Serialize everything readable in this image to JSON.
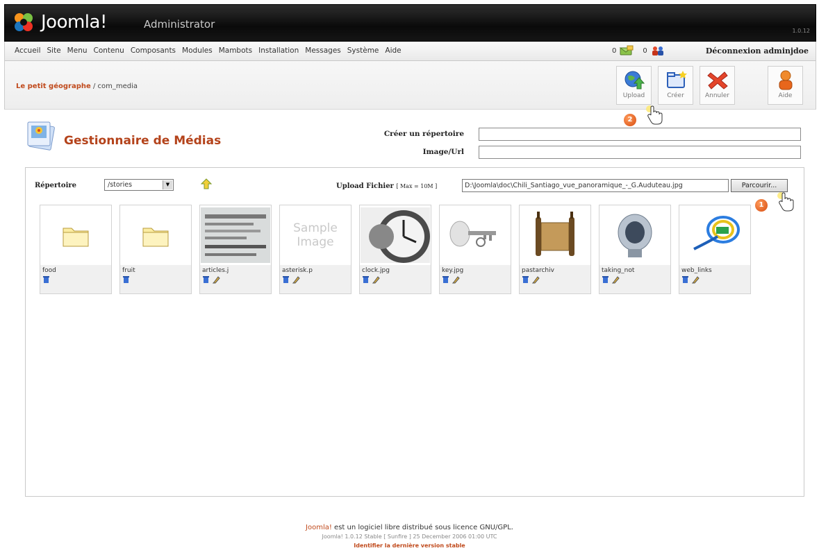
{
  "header": {
    "brand": "Joomla!",
    "subtitle": "Administrator",
    "version": "1.0.12"
  },
  "menu": [
    "Accueil",
    "Site",
    "Menu",
    "Contenu",
    "Composants",
    "Modules",
    "Mambots",
    "Installation",
    "Messages",
    "Système",
    "Aide"
  ],
  "status": {
    "messages": "0",
    "users": "0",
    "logout": "Déconnexion adminjdoe"
  },
  "breadcrumb": {
    "site": "Le petit géographe",
    "path": " / com_media"
  },
  "toolbar": [
    "Upload",
    "Créer",
    "Annuler",
    "Aide"
  ],
  "page_title": "Gestionnaire de Médias",
  "form": {
    "create_dir_label": "Créer un répertoire",
    "image_url_label": "Image/Url"
  },
  "directory": {
    "label": "Répertoire",
    "selected": "/stories"
  },
  "upload": {
    "label": "Upload Fichier",
    "max": "[ Max = 10M ]",
    "file_value": "D:\\Joomla\\doc\\Chili_Santiago_vue_panoramique_-_G.Auduteau.jpg",
    "browse_label": "Parcourir..."
  },
  "media_items": [
    {
      "name": "food",
      "type": "folder"
    },
    {
      "name": "fruit",
      "type": "folder"
    },
    {
      "name": "articles.j",
      "type": "image"
    },
    {
      "name": "asterisk.p",
      "type": "sample"
    },
    {
      "name": "clock.jpg",
      "type": "image"
    },
    {
      "name": "key.jpg",
      "type": "image"
    },
    {
      "name": "pastarchiv",
      "type": "image"
    },
    {
      "name": "taking_not",
      "type": "image"
    },
    {
      "name": "web_links",
      "type": "image"
    }
  ],
  "sample_text": [
    "Sample",
    "Image"
  ],
  "callouts": [
    "1",
    "2"
  ],
  "footer": {
    "joomla": "Joomla!",
    "license": " est un logiciel libre distribué sous licence GNU/GPL.",
    "version_line": "Joomla! 1.0.12 Stable [ Sunfire ] 25 December 2006 01:00 UTC",
    "check_link": "Identifier la dernière version stable"
  },
  "colors": {
    "accent": "#b4431b",
    "header_bg": "#111111"
  }
}
